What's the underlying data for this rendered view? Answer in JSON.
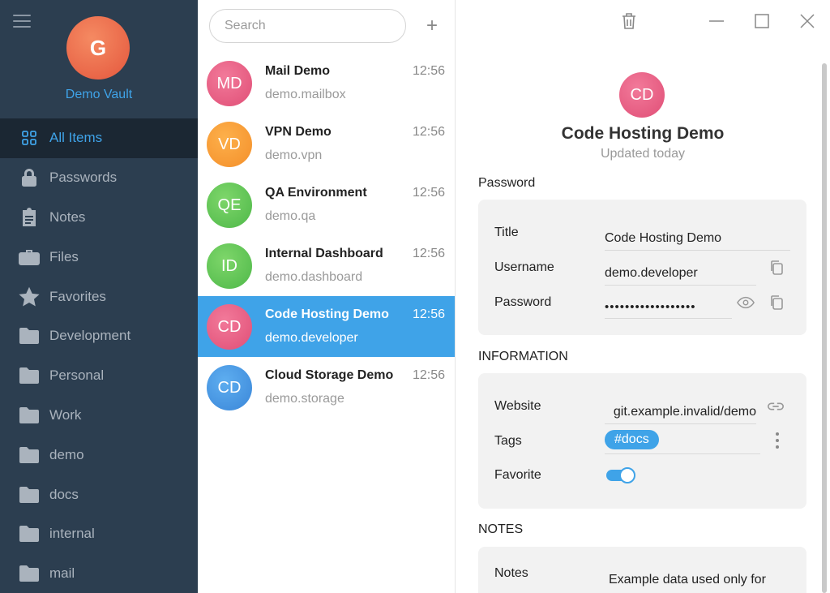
{
  "sidebar": {
    "avatar_letter": "G",
    "vault_name": "Demo Vault",
    "items": [
      {
        "label": "All Items",
        "icon": "grid-icon"
      },
      {
        "label": "Passwords",
        "icon": "lock-icon"
      },
      {
        "label": "Notes",
        "icon": "clipboard-icon"
      },
      {
        "label": "Files",
        "icon": "briefcase-icon"
      },
      {
        "label": "Favorites",
        "icon": "star-icon"
      },
      {
        "label": "Development",
        "icon": "folder-icon"
      },
      {
        "label": "Personal",
        "icon": "folder-icon"
      },
      {
        "label": "Work",
        "icon": "folder-icon"
      },
      {
        "label": "demo",
        "icon": "folder-icon"
      },
      {
        "label": "docs",
        "icon": "folder-icon"
      },
      {
        "label": "internal",
        "icon": "folder-icon"
      },
      {
        "label": "mail",
        "icon": "folder-icon"
      }
    ]
  },
  "list": {
    "search_placeholder": "Search",
    "add_label": "+",
    "items": [
      {
        "initials": "MD",
        "name": "Mail Demo",
        "sub": "demo.mailbox",
        "time": "12:56"
      },
      {
        "initials": "VD",
        "name": "VPN Demo",
        "sub": "demo.vpn",
        "time": "12:56"
      },
      {
        "initials": "QE",
        "name": "QA Environment",
        "sub": "demo.qa",
        "time": "12:56"
      },
      {
        "initials": "ID",
        "name": "Internal Dashboard",
        "sub": "demo.dashboard",
        "time": "12:56"
      },
      {
        "initials": "CD",
        "name": "Code Hosting Demo",
        "sub": "demo.developer",
        "time": "12:56"
      },
      {
        "initials": "CD",
        "name": "Cloud Storage Demo",
        "sub": "demo.storage",
        "time": "12:56"
      }
    ]
  },
  "detail": {
    "initials": "CD",
    "title": "Code Hosting Demo",
    "updated": "Updated today",
    "password_section": "Password",
    "fields": {
      "title_label": "Title",
      "title_value": "Code Hosting Demo",
      "username_label": "Username",
      "username_value": "demo.developer",
      "password_label": "Password",
      "password_value": "••••••••••••••••••"
    },
    "info_section": "INFORMATION",
    "info": {
      "website_label": "Website",
      "website_value": "git.example.invalid/demo",
      "tags_label": "Tags",
      "tag_value": "#docs",
      "favorite_label": "Favorite"
    },
    "notes_section": "NOTES",
    "notes": {
      "label": "Notes",
      "value": "Example data used only for"
    }
  },
  "colors": {
    "sidebar_bg": "#2c3e50",
    "accent": "#3fa3e8",
    "card_bg": "#f2f2f2"
  }
}
